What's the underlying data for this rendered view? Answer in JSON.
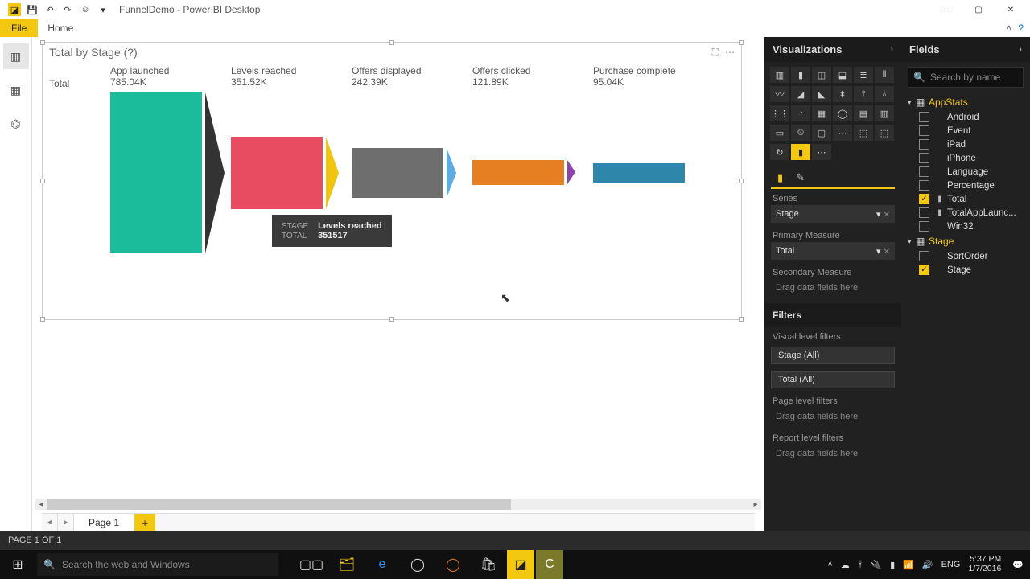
{
  "window": {
    "title": "FunnelDemo - Power BI Desktop",
    "file_tab": "File",
    "home_tab": "Home"
  },
  "visual": {
    "title": "Total by Stage (?)",
    "row_label": "Total"
  },
  "chart_data": {
    "type": "bar",
    "title": "Total by Stage",
    "xlabel": "Stage",
    "ylabel": "Total",
    "categories": [
      "App launched",
      "Levels reached",
      "Offers displayed",
      "Offers clicked",
      "Purchase complete"
    ],
    "values": [
      785040,
      351520,
      242390,
      121890,
      95040
    ],
    "display_values": [
      "785.04K",
      "351.52K",
      "242.39K",
      "121.89K",
      "95.04K"
    ],
    "colors": [
      "#1abc9c",
      "#e74c60",
      "#6e6e6e",
      "#e67e22",
      "#2e86ab"
    ],
    "ylim": [
      0,
      800000
    ]
  },
  "tooltip": {
    "stage_label": "STAGE",
    "stage_value": "Levels reached",
    "total_label": "TOTAL",
    "total_value": "351517"
  },
  "viz_pane": {
    "header": "Visualizations",
    "series_label": "Series",
    "series_value": "Stage",
    "primary_label": "Primary Measure",
    "primary_value": "Total",
    "secondary_label": "Secondary Measure",
    "secondary_placeholder": "Drag data fields here",
    "filters_header": "Filters",
    "visual_filters_label": "Visual level filters",
    "filter1": "Stage (All)",
    "filter2": "Total (All)",
    "page_filters_label": "Page level filters",
    "page_filters_placeholder": "Drag data fields here",
    "report_filters_label": "Report level filters",
    "report_filters_placeholder": "Drag data fields here"
  },
  "fields_pane": {
    "header": "Fields",
    "search_placeholder": "Search by name",
    "tables": [
      {
        "name": "AppStats",
        "fields": [
          {
            "name": "Android",
            "checked": false,
            "icon": ""
          },
          {
            "name": "Event",
            "checked": false,
            "icon": ""
          },
          {
            "name": "iPad",
            "checked": false,
            "icon": ""
          },
          {
            "name": "iPhone",
            "checked": false,
            "icon": ""
          },
          {
            "name": "Language",
            "checked": false,
            "icon": ""
          },
          {
            "name": "Percentage",
            "checked": false,
            "icon": ""
          },
          {
            "name": "Total",
            "checked": true,
            "icon": "▮"
          },
          {
            "name": "TotalAppLaunc...",
            "checked": false,
            "icon": "▮"
          },
          {
            "name": "Win32",
            "checked": false,
            "icon": ""
          }
        ]
      },
      {
        "name": "Stage",
        "fields": [
          {
            "name": "SortOrder",
            "checked": false,
            "icon": ""
          },
          {
            "name": "Stage",
            "checked": true,
            "icon": ""
          }
        ]
      }
    ]
  },
  "page_tabs": {
    "page1": "Page 1"
  },
  "status": {
    "text": "PAGE 1 OF 1"
  },
  "taskbar": {
    "search_placeholder": "Search the web and Windows",
    "lang": "ENG",
    "time": "5:37 PM",
    "date": "1/7/2016"
  }
}
